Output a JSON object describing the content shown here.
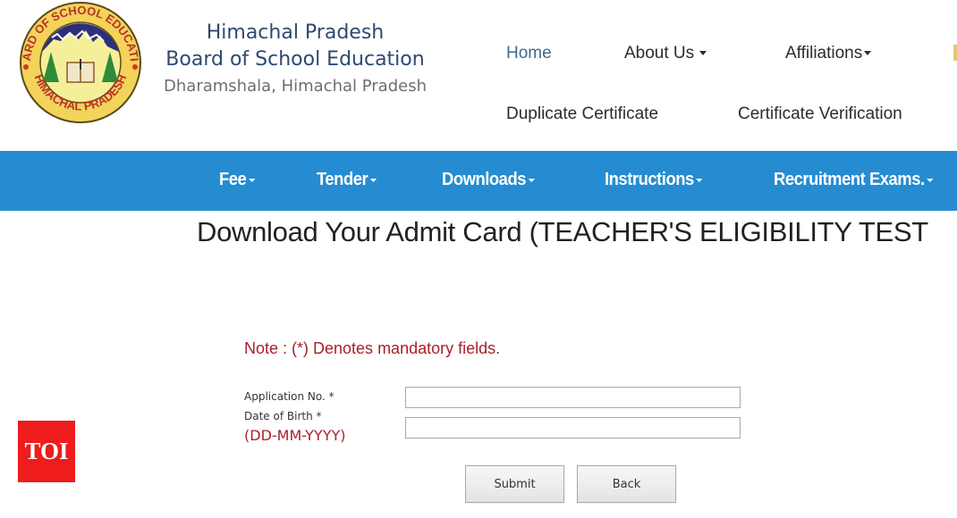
{
  "header": {
    "brand_line1": "Himachal Pradesh",
    "brand_line2": "Board of School Education",
    "brand_line3": "Dharamshala, Himachal Pradesh",
    "logo": {
      "name": "hpbose-emblem",
      "ring_text_top": "BOARD OF SCHOOL EDUCATION",
      "ring_text_bottom": "HIMACHAL PRADESH",
      "colors": {
        "ring": "#f3d35a",
        "center": "#f6ef9a",
        "mountains": "#2d2f7a",
        "trees": "#2e8b3a",
        "dots": "#d6332b"
      }
    }
  },
  "top_nav": {
    "row1": [
      {
        "label": "Home",
        "active": true,
        "dropdown": false
      },
      {
        "label": "About Us",
        "active": false,
        "dropdown": true
      },
      {
        "label": "Affiliations",
        "active": false,
        "dropdown": true
      }
    ],
    "row2": [
      {
        "label": "Duplicate Certificate",
        "active": false,
        "dropdown": false
      },
      {
        "label": "Certificate Verification",
        "active": false,
        "dropdown": false
      }
    ]
  },
  "blue_nav": {
    "color": "#258cd1",
    "items": [
      {
        "label": "Fee",
        "dropdown": true
      },
      {
        "label": "Tender",
        "dropdown": true
      },
      {
        "label": "Downloads",
        "dropdown": true
      },
      {
        "label": "Instructions",
        "dropdown": true
      },
      {
        "label": "Recruitment Exams.",
        "dropdown": true
      }
    ]
  },
  "page": {
    "title": "Download Your Admit Card (TEACHER'S ELIGIBILITY TEST"
  },
  "form": {
    "note": "Note  : (*) Denotes mandatory fields.",
    "fields": [
      {
        "label": "Application No. *",
        "value": "",
        "placeholder": ""
      },
      {
        "label": "Date of Birth *",
        "hint": "(DD-MM-YYYY)",
        "value": "",
        "placeholder": ""
      }
    ],
    "submit_label": "Submit",
    "back_label": "Back",
    "accent_color": "#a8212a"
  },
  "watermark": {
    "text": "TOI",
    "color": "#ee1c1c"
  }
}
